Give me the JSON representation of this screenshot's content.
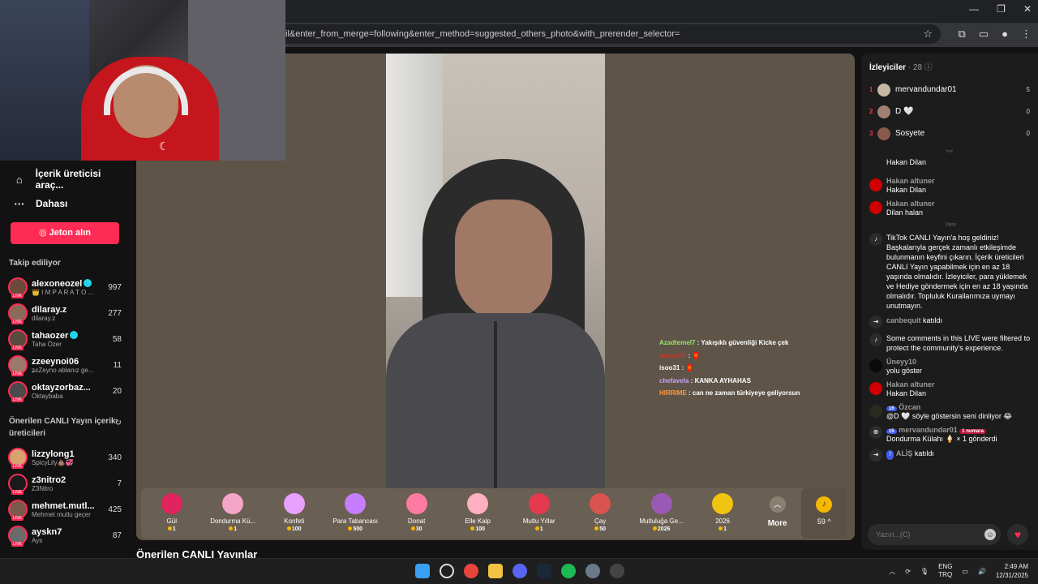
{
  "browser": {
    "url": "il&enter_from_merge=following&enter_method=suggested_others_photo&with_prerender_selector=",
    "controls": [
      "—",
      "❐",
      "✕"
    ]
  },
  "sidebar": {
    "nav": [
      {
        "label": "İçerik üreticisi araç...",
        "icon": "home-icon"
      },
      {
        "label": "Dahası",
        "icon": "more-icon"
      }
    ],
    "coins_button": "Jeton alın",
    "following_title": "Takip ediliyor",
    "following": [
      {
        "name": "alexoneozel",
        "sub": "👑 I M P A R A T O ...",
        "count": "997",
        "verified": true
      },
      {
        "name": "dilaray.z",
        "sub": "dilaray.z",
        "count": "277",
        "verified": false
      },
      {
        "name": "tahaozer",
        "sub": "Taha Özer",
        "count": "58",
        "verified": true
      },
      {
        "name": "zzeeynoi06",
        "sub": "ʑєZeyno ablanız ge...",
        "count": "11",
        "verified": false
      },
      {
        "name": "oktayzorbaz...",
        "sub": "Oktaybaba",
        "count": "20",
        "verified": false
      }
    ],
    "suggested_title": "Önerilen CANLI Yayın içerik üreticileri",
    "suggested": [
      {
        "name": "lizzylong1",
        "sub": "SpicyLily💩💞",
        "count": "340"
      },
      {
        "name": "z3nitro2",
        "sub": "Z3Nitro",
        "count": "7"
      },
      {
        "name": "mehmet.mutl...",
        "sub": "Mehmet mutlu geçer",
        "count": "425"
      },
      {
        "name": "ayskn7",
        "sub": "Ays",
        "count": "87"
      }
    ],
    "live_badge": "LIVE"
  },
  "overlay_chat": [
    {
      "user": "Azadtemel7",
      "text": " : Yakışıklı güvenliği Kicke çek",
      "color": "#9be36a"
    },
    {
      "user": "Agosy90",
      "text": " : 🧧",
      "color": "#c0392b"
    },
    {
      "user": "isoo31",
      "text": " : 🧧",
      "color": "#ffffff"
    },
    {
      "user": "chefavela",
      "text": " : KANKA AYHAHAS",
      "color": "#c9a3ff"
    },
    {
      "user": "HIRRIME",
      "text": " : can ne zaman türkiyeye geliyorsun",
      "color": "#ff9a3c"
    }
  ],
  "gifts": [
    {
      "name": "Gül",
      "price": "1",
      "color": "#e0245e"
    },
    {
      "name": "Dondurma Kü...",
      "price": "1",
      "color": "#f4a6c8"
    },
    {
      "name": "Konfeti",
      "price": "100",
      "color": "#e8a0ff"
    },
    {
      "name": "Para Tabancası",
      "price": "500",
      "color": "#c77dff"
    },
    {
      "name": "Donat",
      "price": "30",
      "color": "#ff7aa2"
    },
    {
      "name": "Elle Kalp",
      "price": "100",
      "color": "#ffb0c0"
    },
    {
      "name": "Mutlu Yıllar",
      "price": "1",
      "color": "#e53950"
    },
    {
      "name": "Çay",
      "price": "50",
      "color": "#d9534f"
    },
    {
      "name": "Mutluluğa Ge...",
      "price": "2026",
      "color": "#9b59b6"
    },
    {
      "name": "2026",
      "price": "1",
      "color": "#f1c40f"
    }
  ],
  "gift_more": "More",
  "coin_balance": "59 ^",
  "recommended_title": "Önerilen CANLI Yayınlar",
  "viewers": {
    "title": "İzleyiciler",
    "count": "· 28",
    "list": [
      {
        "rank": "1",
        "name": "mervandundar01",
        "score": "5"
      },
      {
        "rank": "2",
        "name": "D 🤍",
        "score": "0"
      },
      {
        "rank": "3",
        "name": "Sosyete",
        "score": "0"
      }
    ]
  },
  "chat": {
    "partial_top": "Hakan Dilan",
    "msgs": [
      {
        "name": "Hakan altuner",
        "text": "Hakan Dilan",
        "avatar": "#d10000"
      },
      {
        "name": "Hakan altuner",
        "text": "Dilan halan",
        "avatar": "#d10000"
      }
    ],
    "divider": "Yeni",
    "welcome": "TikTok CANLI Yayın'a hoş geldiniz! Başkalarıyla gerçek zamanlı etkileşimde bulunmanın keyfini çıkarın. İçerik üreticileri CANLI Yayın yapabilmek için en az 18 yaşında olmalıdır. İzleyiciler, para yüklemek ve Hediye göndermek için en az 18 yaşında olmalıdır. Topluluk Kurallarımıza uymayı unutmayın.",
    "joined1_name": "canbequit",
    "joined1_text": "katıldı",
    "filtered": "Some comments in this LIVE were filtered to protect the community's experience.",
    "msgs2": [
      {
        "name": "Üneyy10",
        "text": "yolu göster",
        "avatar": "#0a0a0a"
      },
      {
        "name": "Hakan altuner",
        "text": "Hakan Dilan",
        "avatar": "#d10000"
      }
    ],
    "ozcan_level": "16",
    "ozcan_name": "Özcan",
    "ozcan_text": "@D 🤍 söyle göstersin seni dinliyor 😂",
    "gift_level": "15",
    "gift_user": "mervandundar01",
    "gift_badge": "1 numara",
    "gift_text": "Dondurma Külahı 🍦 × 1 gönderdi",
    "joined2_level": "7",
    "joined2_name": "ALİŞ",
    "joined2_text": "katıldı",
    "input_placeholder": "Yazın...(C)"
  },
  "taskbar": {
    "lang1": "ENG",
    "lang2": "TRQ",
    "time": "2:49 AM",
    "date": "12/31/2025"
  }
}
